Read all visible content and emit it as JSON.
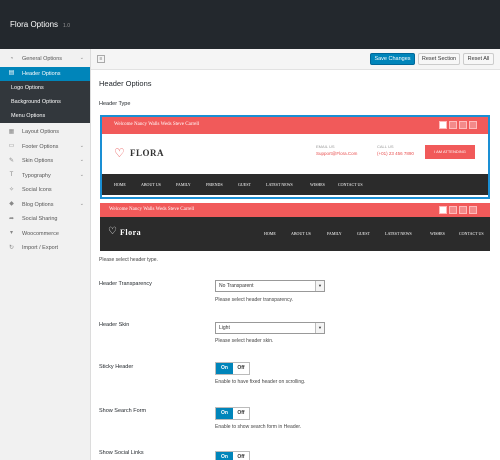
{
  "app": {
    "title": "Flora Options",
    "version": "1.0"
  },
  "sidebar": {
    "items": [
      {
        "label": "General Options",
        "icon": "dashboard-icon"
      },
      {
        "label": "Header Options",
        "icon": "header-icon"
      },
      {
        "label": "Layout Options",
        "icon": "layout-icon"
      },
      {
        "label": "Footer Options",
        "icon": "footer-icon"
      },
      {
        "label": "Skin Options",
        "icon": "brush-icon"
      },
      {
        "label": "Typography",
        "icon": "typography-icon"
      },
      {
        "label": "Social Icons",
        "icon": "social-icon"
      },
      {
        "label": "Blog Options",
        "icon": "tag-icon"
      },
      {
        "label": "Social Sharing",
        "icon": "share-icon"
      },
      {
        "label": "Woocommerce",
        "icon": "cart-icon"
      },
      {
        "label": "Import / Export",
        "icon": "refresh-icon"
      }
    ],
    "subitems": [
      "Logo Options",
      "Background Options",
      "Menu Options"
    ]
  },
  "toolbar": {
    "save": "Save Changes",
    "reset_section": "Reset Section",
    "reset_all": "Reset All"
  },
  "section": {
    "title": "Header Options"
  },
  "header_type": {
    "label": "Header Type",
    "description": "Please select header type.",
    "preview1": {
      "welcome": "Welcome Nancy Walls Weds Steve Carrell",
      "logo": "FLORA",
      "email_label": "EMAIL US",
      "email_value": "Support@Flora.Com",
      "call_label": "CALL US",
      "call_value": "(+01) 23 456 7890",
      "cta": "I AM ATTENDING",
      "nav": [
        "HOME",
        "ABOUT US",
        "FAMILY",
        "FRIENDS",
        "GUEST",
        "LATEST NEWS",
        "WISHES",
        "CONTACT US"
      ]
    },
    "preview2": {
      "welcome": "Welcome Nancy Walls Weds Steve Carrell",
      "logo": "Flora",
      "nav": [
        "HOME",
        "ABOUT US",
        "FAMILY",
        "GUEST",
        "LATEST NEWS",
        "WISHES",
        "CONTACT US"
      ]
    }
  },
  "transparency": {
    "label": "Header Transparency",
    "value": "No Transparent",
    "description": "Please select header transparency."
  },
  "skin": {
    "label": "Header Skin",
    "value": "Light",
    "description": "Please select header skin."
  },
  "sticky": {
    "label": "Sticky Header",
    "on": "On",
    "off": "Off",
    "description": "Enable to have fixed header on scrolling."
  },
  "search": {
    "label": "Show Search Form",
    "on": "On",
    "off": "Off",
    "description": "Enable to show search form in Header."
  },
  "social_links": {
    "label": "Show Social Links",
    "on": "On",
    "off": "Off"
  },
  "colors": {
    "accent": "#0085ba",
    "brand_red": "#f15a5a",
    "dark": "#23282d"
  }
}
